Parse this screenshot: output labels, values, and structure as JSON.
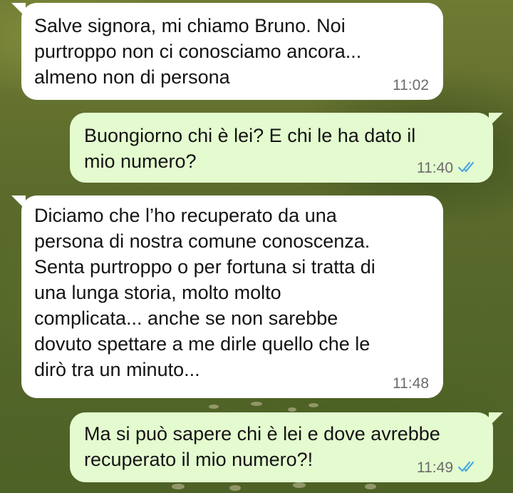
{
  "chat": {
    "messages": [
      {
        "direction": "incoming",
        "text": "Salve signora, mi chiamo Bruno. Noi\npurtroppo non ci conosciamo ancora...\nalmeno non di persona",
        "time": "11:02"
      },
      {
        "direction": "outgoing",
        "text": "Buongiorno chi è lei? E chi le ha dato il\nmio numero?",
        "time": "11:40",
        "status_icon": "double-check-read-icon"
      },
      {
        "direction": "incoming",
        "text": "Diciamo che l’ho recuperato da una\npersona di nostra comune conoscenza.\nSenta purtroppo o per fortuna si tratta di\nuna lunga storia, molto molto\ncomplicata... anche se non sarebbe\ndovuto spettare a me dirle quello che le\ndirò tra un minuto...",
        "time": "11:48"
      },
      {
        "direction": "outgoing",
        "text": "Ma si può sapere chi è lei e dove avrebbe\nrecuperato il mio numero?!",
        "time": "11:49",
        "status_icon": "double-check-read-icon"
      }
    ]
  },
  "colors": {
    "incoming_bubble": "#ffffff",
    "outgoing_bubble": "#e4fbcf",
    "read_check": "#4fa8e0",
    "timestamp": "#6b6b6b",
    "wallpaper": "#5d6c2c"
  }
}
